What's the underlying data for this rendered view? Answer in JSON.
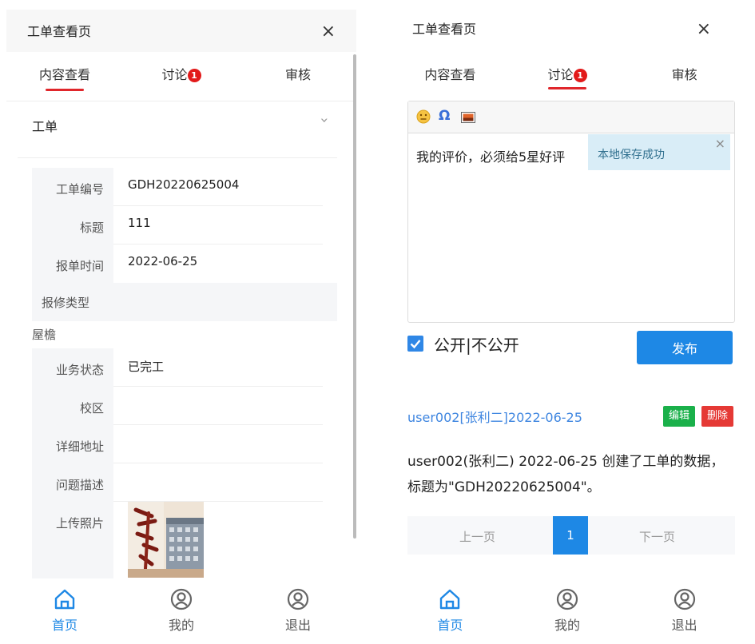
{
  "left": {
    "header": {
      "title": "工单查看页",
      "close": "×"
    },
    "tabs": [
      {
        "label": "内容查看",
        "badge": "",
        "active": true
      },
      {
        "label": "讨论",
        "badge": "1",
        "active": false
      },
      {
        "label": "审核",
        "badge": "",
        "active": false
      }
    ],
    "section": {
      "title": "工单",
      "chevron": "‹"
    },
    "fields": [
      {
        "label": "工单编号",
        "value": "GDH20220625004"
      },
      {
        "label": "标题",
        "value": "111"
      },
      {
        "label": "报单时间",
        "value": "2022-06-25"
      }
    ],
    "repair_type_label": "报修类型",
    "repair_type_value": "屋檐",
    "fields2": [
      {
        "label": "业务状态",
        "value": "已完工"
      },
      {
        "label": "校区",
        "value": ""
      },
      {
        "label": "详细地址",
        "value": ""
      },
      {
        "label": "问题描述",
        "value": ""
      },
      {
        "label": "上传照片",
        "value": ""
      }
    ]
  },
  "right": {
    "header": {
      "title": "工单查看页",
      "close": "×"
    },
    "tabs": [
      {
        "label": "内容查看",
        "badge": "",
        "active": false
      },
      {
        "label": "讨论",
        "badge": "1",
        "active": true
      },
      {
        "label": "审核",
        "badge": "",
        "active": false
      }
    ],
    "editor": {
      "omega": "Ω",
      "text": "我的评价，必须给5星好评"
    },
    "toast": {
      "message": "本地保存成功",
      "close": "×"
    },
    "visibility_label": "公开|不公开",
    "publish_label": "发布",
    "comment": {
      "author": "user002[张利二]2022-06-25",
      "edit_label": "编辑",
      "delete_label": "删除",
      "body": "user002(张利二) 2022-06-25 创建了工单的数据，标题为\"GDH20220625004\"。"
    },
    "pager": {
      "prev": "上一页",
      "current": "1",
      "next": "下一页"
    }
  },
  "nav": [
    {
      "label": "首页",
      "icon": "home-icon",
      "active": true
    },
    {
      "label": "我的",
      "icon": "user-icon",
      "active": false
    },
    {
      "label": "退出",
      "icon": "logout-icon",
      "active": false
    }
  ],
  "colors": {
    "accent": "#1e88e5",
    "underline": "#e0262b",
    "badge": "#e21a1a",
    "edit": "#1ab04a",
    "delete": "#e53935"
  }
}
